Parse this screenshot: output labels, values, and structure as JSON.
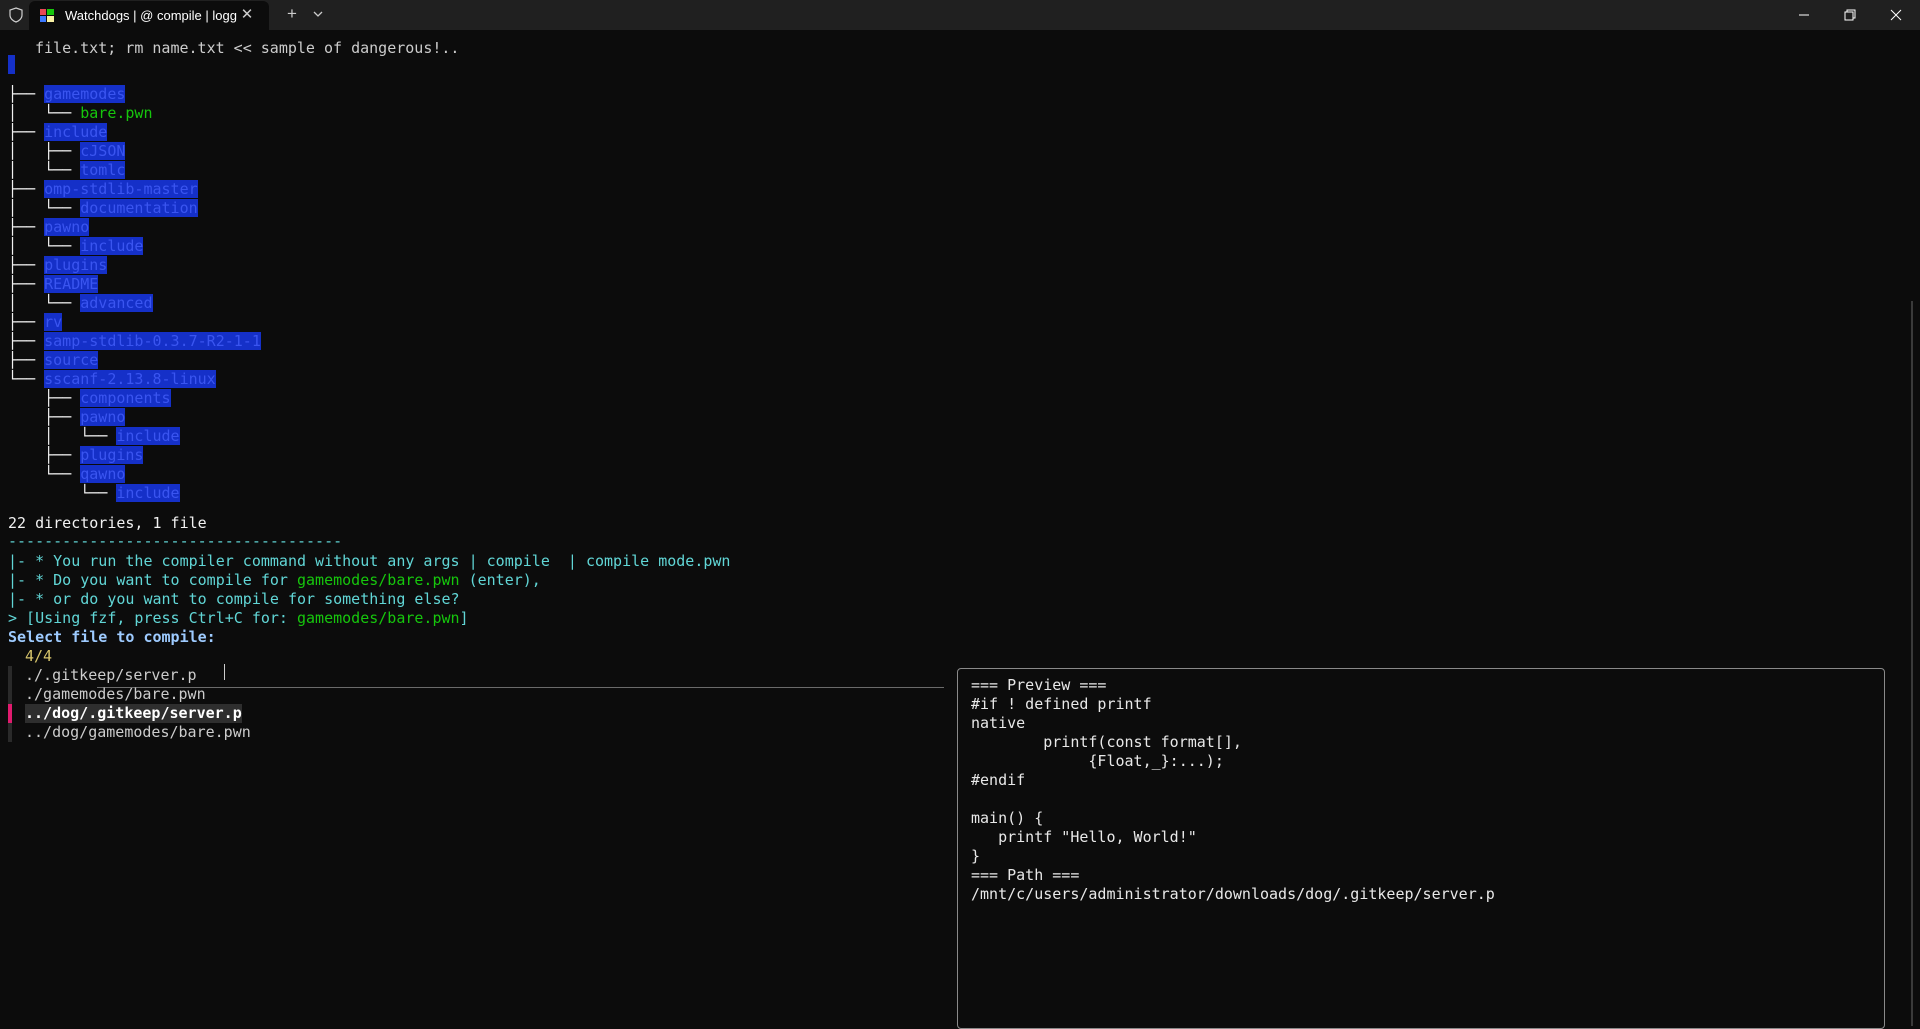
{
  "window": {
    "tab_title": "Watchdogs | @ compile | logg",
    "tab_close_glyph": "✕",
    "new_tab_glyph": "+"
  },
  "terminal": {
    "warning_line": "file.txt; rm name.txt << sample of dangerous!..",
    "tree": [
      {
        "prefix": "├── ",
        "name": "gamemodes",
        "style": "sel"
      },
      {
        "prefix": "│   └── ",
        "name": "bare.pwn",
        "style": "green"
      },
      {
        "prefix": "├── ",
        "name": "include",
        "style": "sel"
      },
      {
        "prefix": "│   ├── ",
        "name": "cJSON",
        "style": "sel"
      },
      {
        "prefix": "│   └── ",
        "name": "tomlc",
        "style": "sel"
      },
      {
        "prefix": "├── ",
        "name": "omp-stdlib-master",
        "style": "sel"
      },
      {
        "prefix": "│   └── ",
        "name": "documentation",
        "style": "sel"
      },
      {
        "prefix": "├── ",
        "name": "pawno",
        "style": "sel"
      },
      {
        "prefix": "│   └── ",
        "name": "include",
        "style": "sel"
      },
      {
        "prefix": "├── ",
        "name": "plugins",
        "style": "sel"
      },
      {
        "prefix": "├── ",
        "name": "README",
        "style": "sel"
      },
      {
        "prefix": "│   └── ",
        "name": "advanced",
        "style": "sel"
      },
      {
        "prefix": "├── ",
        "name": "rv",
        "style": "sel"
      },
      {
        "prefix": "├── ",
        "name": "samp-stdlib-0.3.7-R2-1-1",
        "style": "sel"
      },
      {
        "prefix": "├── ",
        "name": "source",
        "style": "sel"
      },
      {
        "prefix": "└── ",
        "name": "sscanf-2.13.8-linux",
        "style": "sel"
      },
      {
        "prefix": "    ├── ",
        "name": "components",
        "style": "sel"
      },
      {
        "prefix": "    ├── ",
        "name": "pawno",
        "style": "sel"
      },
      {
        "prefix": "    │   └── ",
        "name": "include",
        "style": "sel"
      },
      {
        "prefix": "    ├── ",
        "name": "plugins",
        "style": "sel"
      },
      {
        "prefix": "    └── ",
        "name": "qawno",
        "style": "sel"
      },
      {
        "prefix": "        └── ",
        "name": "include",
        "style": "sel"
      }
    ],
    "summary": "22 directories, 1 file",
    "separator": "-------------------------------------",
    "msg1": {
      "a": "|- * You run the compiler command without any args | compile  | compile mode.pwn"
    },
    "msg2": {
      "a": "|- * Do you want to compile for ",
      "b": "gamemodes/bare.pwn",
      "c": " (enter),"
    },
    "msg3": {
      "a": "|- * or do you want to compile for something else?"
    },
    "msg4": {
      "a": "> [Using fzf, press Ctrl+C for: ",
      "b": "gamemodes/bare.pwn",
      "c": "]"
    },
    "prompt": "Select file to compile: ",
    "fzf_count": "4/4",
    "fzf_items": [
      "./.gitkeep/server.p",
      "./gamemodes/bare.pwn",
      "../dog/.gitkeep/server.p",
      "../dog/gamemodes/bare.pwn"
    ],
    "fzf_selected_index": 2
  },
  "preview": {
    "lines": [
      "=== Preview ===",
      "#if ! defined printf",
      "native",
      "        printf(const format[],",
      "             {Float,_}:...);",
      "#endif",
      "",
      "main() {",
      "   printf \"Hello, World!\"",
      "}",
      "=== Path ===",
      "/mnt/c/users/administrator/downloads/dog/.gitkeep/server.p"
    ]
  },
  "colors": {
    "background": "#0c0c0c",
    "selection": "#1530c8",
    "green": "#16c60c",
    "cyan": "#61d6d6",
    "fzf_marker": "#e01b6e"
  }
}
